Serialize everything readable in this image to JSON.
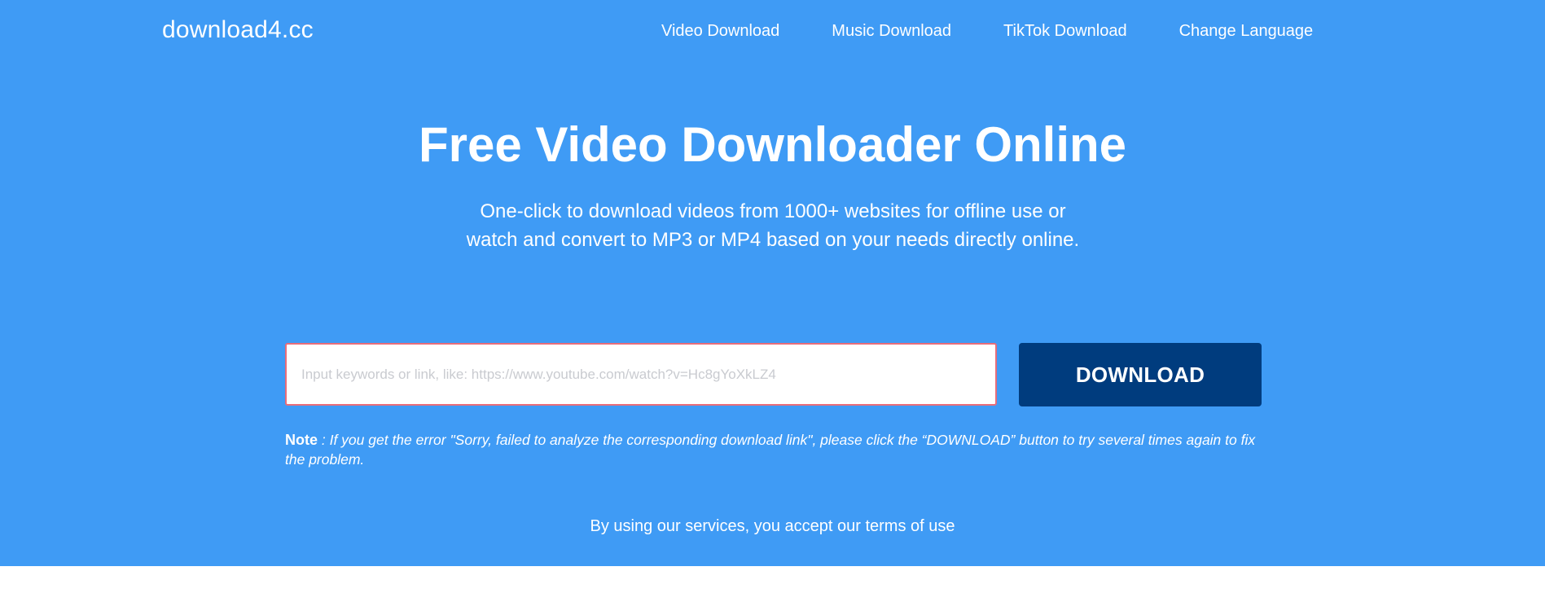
{
  "header": {
    "logo": "download4.cc",
    "nav": [
      {
        "label": "Video Download"
      },
      {
        "label": "Music Download"
      },
      {
        "label": "TikTok Download"
      },
      {
        "label": "Change Language"
      }
    ]
  },
  "hero": {
    "title": "Free Video Downloader Online",
    "subtitle": "One-click to download videos from 1000+ websites for offline use or watch and convert to MP3 or MP4 based on your needs directly online."
  },
  "search": {
    "value": "",
    "placeholder": "Input keywords or link, like: https://www.youtube.com/watch?v=Hc8gYoXkLZ4",
    "button_label": "DOWNLOAD"
  },
  "note": {
    "label": "Note",
    "separator": " :  ",
    "text": "If you get the error \"Sorry, failed to analyze the corresponding download link\", please click the “DOWNLOAD” button to try several times again to fix the problem."
  },
  "footer": {
    "terms": "By using our services, you accept our terms of use"
  },
  "colors": {
    "background": "#3f9bf5",
    "button": "#003c7e",
    "input_border": "#e86d7a",
    "text": "#ffffff"
  }
}
